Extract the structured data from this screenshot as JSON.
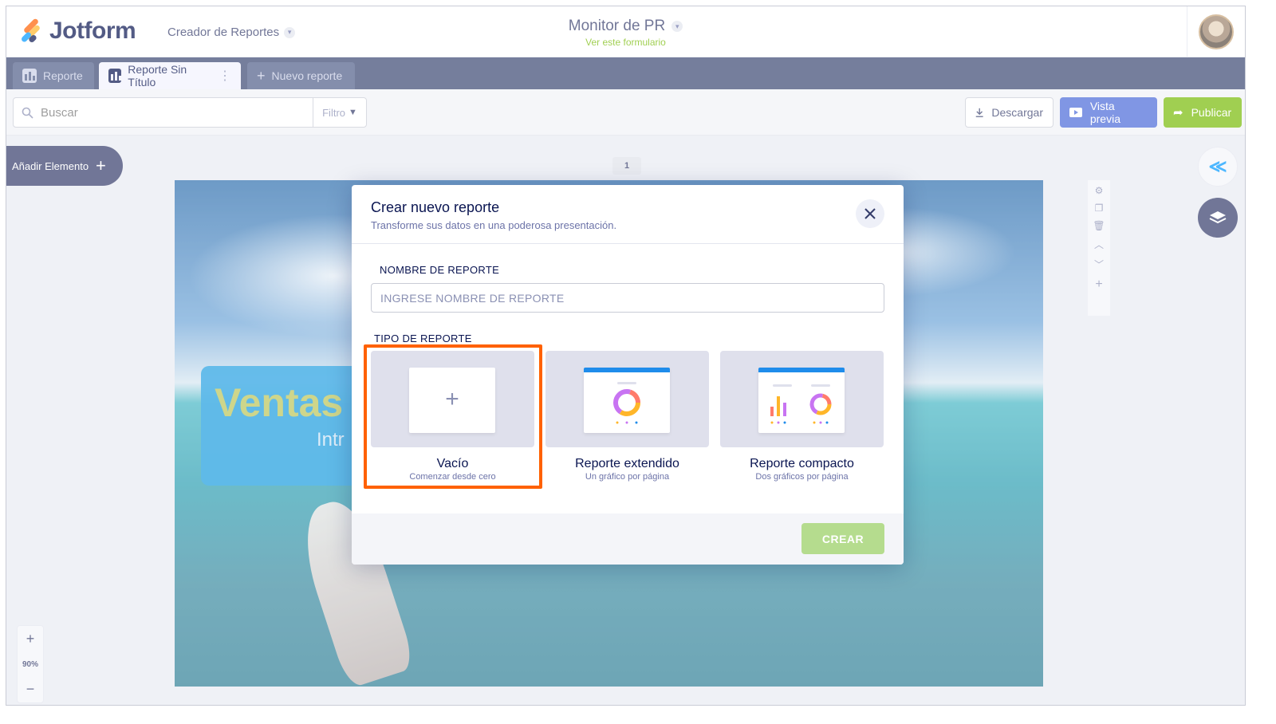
{
  "header": {
    "logo_text": "Jotform",
    "app_name": "Creador de Reportes",
    "form_title": "Monitor de PR",
    "view_form_link": "Ver este formulario"
  },
  "tabs": [
    {
      "label": "Reporte",
      "icon": "bar-chart-icon",
      "active": false
    },
    {
      "label": "Reporte Sin Título",
      "icon": "bar-chart-icon",
      "active": true
    },
    {
      "label": "Nuevo reporte",
      "icon": "plus-icon",
      "active": false
    }
  ],
  "toolbar": {
    "search_placeholder": "Buscar",
    "filter_label": "Filtro",
    "download_label": "Descargar",
    "preview_label": "Vista previa",
    "publish_label": "Publicar"
  },
  "workspace": {
    "add_element_label": "Añadir Elemento",
    "page_number": "1",
    "slide_title": "Ventas",
    "slide_subtitle": "Intr",
    "zoom_level": "90%"
  },
  "modal": {
    "title": "Crear nuevo reporte",
    "subtitle": "Transforme sus datos en una poderosa presentación.",
    "name_label": "NOMBRE DE REPORTE",
    "name_placeholder": "INGRESE NOMBRE DE REPORTE",
    "type_label": "TIPO DE REPORTE",
    "options": [
      {
        "name": "Vacío",
        "description": "Comenzar desde cero",
        "selected": true
      },
      {
        "name": "Reporte extendido",
        "description": "Un gráfico por página",
        "selected": false
      },
      {
        "name": "Reporte compacto",
        "description": "Dos gráficos por página",
        "selected": false
      }
    ],
    "create_label": "CREAR"
  },
  "colors": {
    "brand_navy": "#0a1551",
    "tab_bar": "#3a4772",
    "preview_blue": "#4a69d9",
    "publish_green": "#78bb07",
    "highlight_orange": "#ff6100",
    "create_disabled": "#b5dc8e"
  }
}
